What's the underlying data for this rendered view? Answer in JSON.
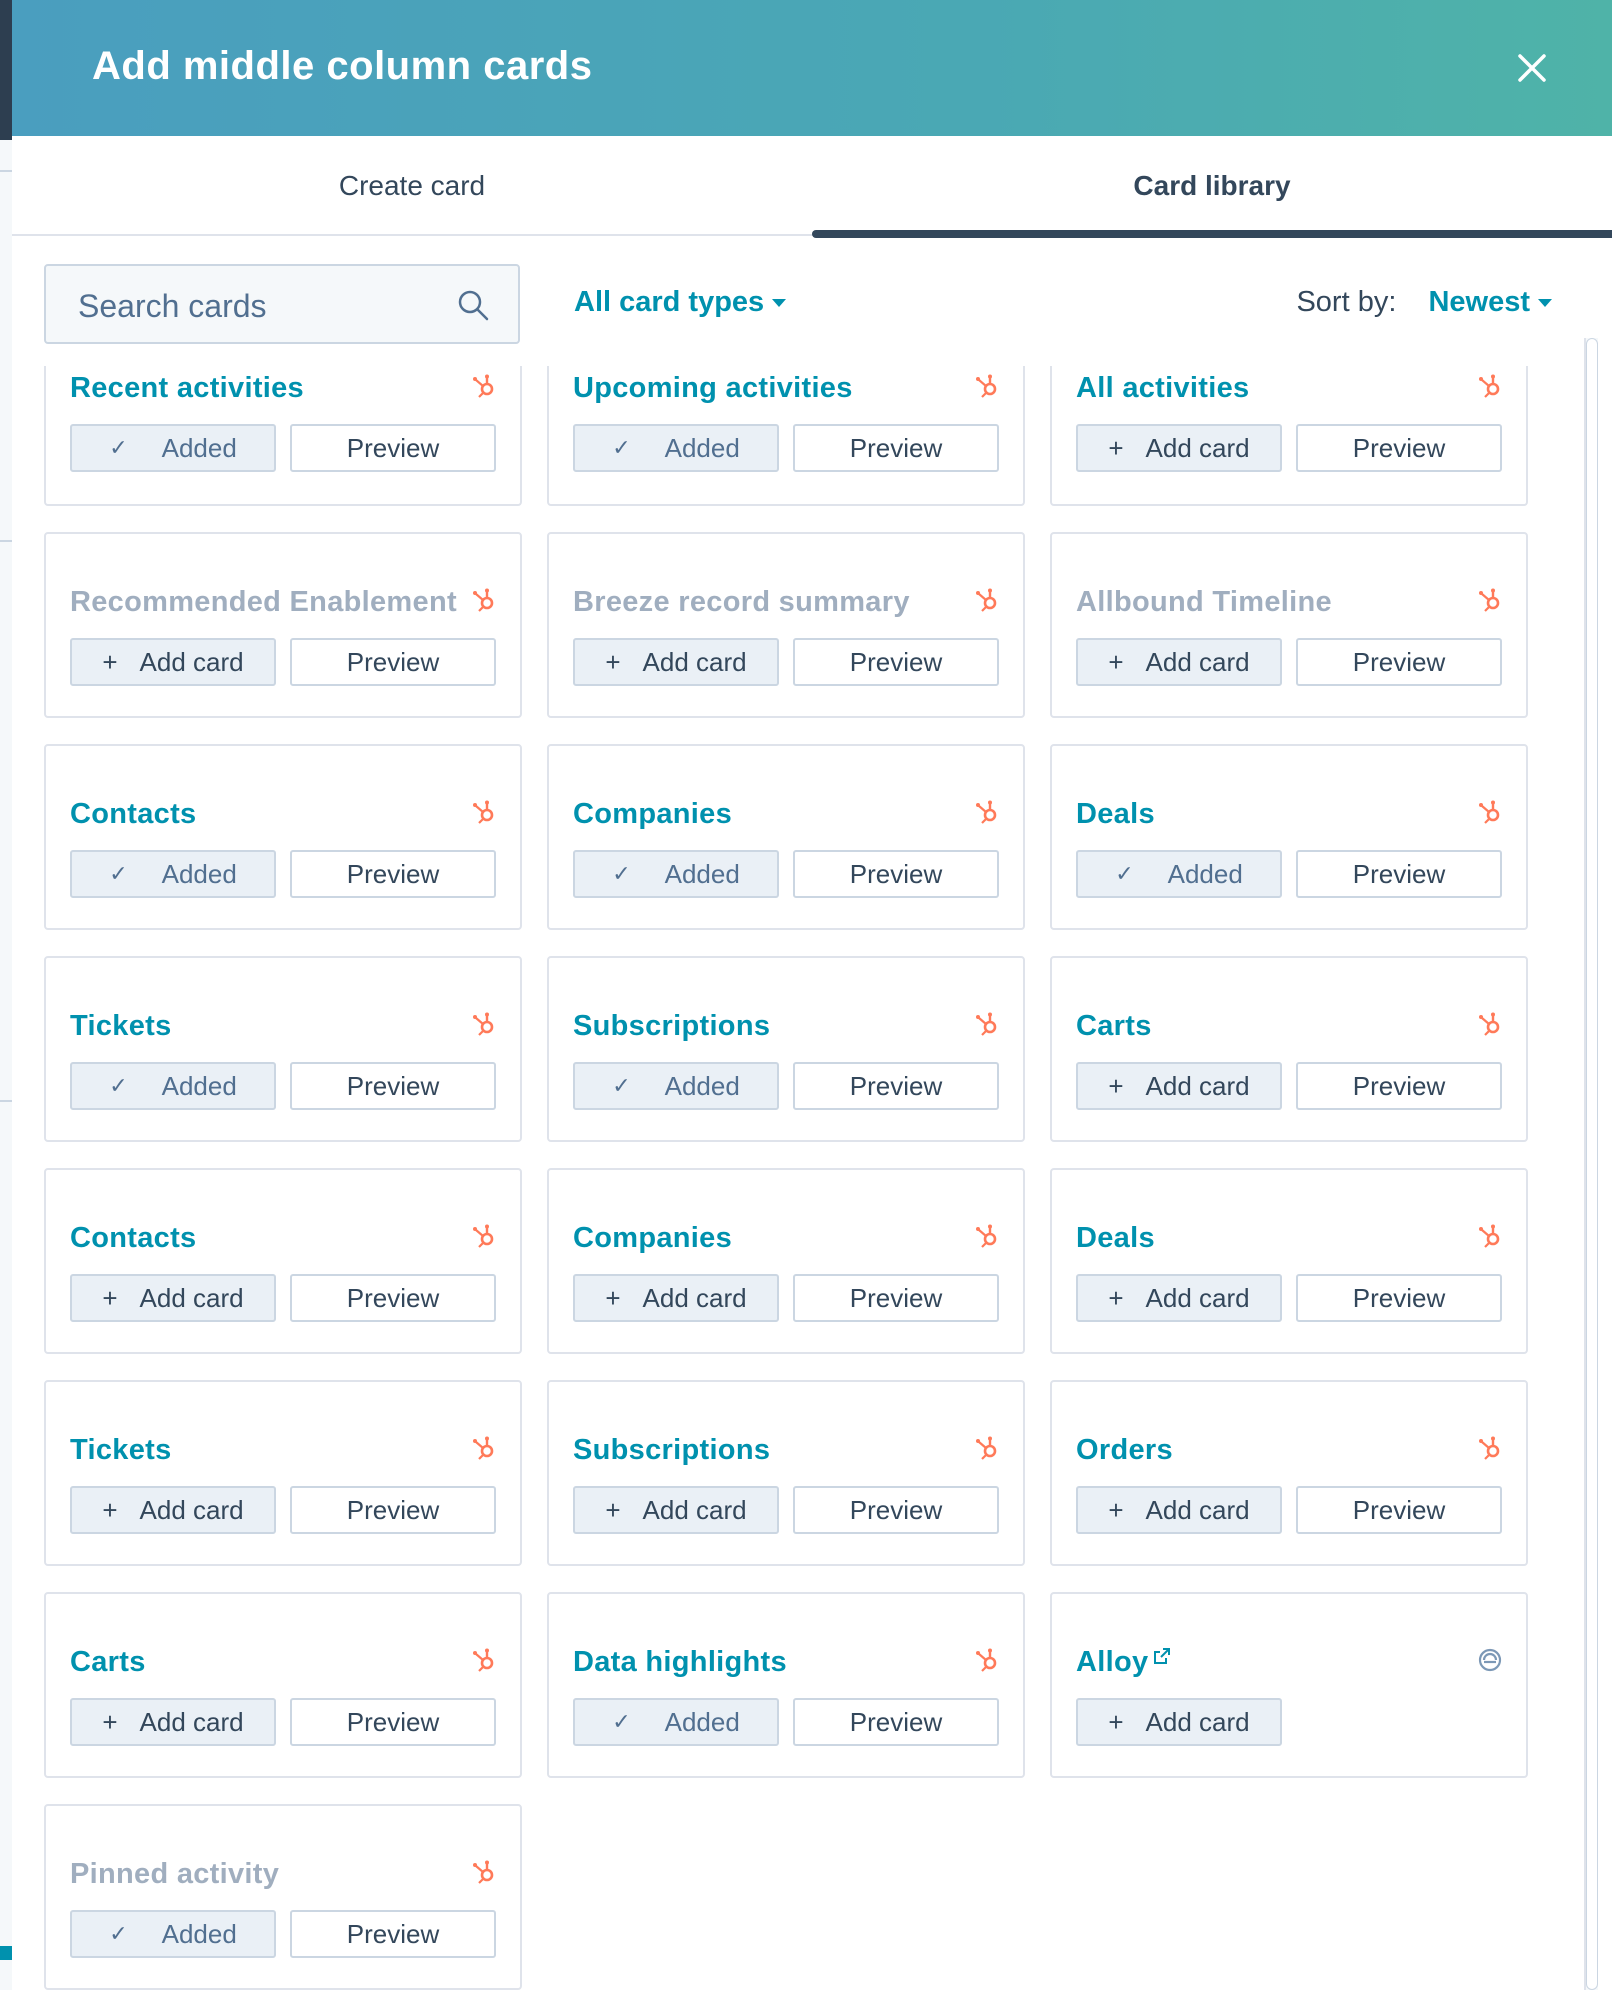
{
  "modal": {
    "title": "Add middle column cards",
    "close_icon": "close-icon"
  },
  "tabs": [
    {
      "label": "Create card",
      "active": false
    },
    {
      "label": "Card library",
      "active": true
    }
  ],
  "toolbar": {
    "search_placeholder": "Search cards",
    "filter_label": "All card types",
    "sort_label": "Sort by:",
    "sort_value": "Newest"
  },
  "colors": {
    "accent": "#0091ae",
    "header_start": "#4a9ebf",
    "header_end": "#4fb3a8",
    "hubspot_orange": "#ff7a59",
    "muted_title": "#a0aebf"
  },
  "cards": [
    {
      "title": "Recent activities",
      "status": "Added",
      "preview": "Preview",
      "logo": "hubspot-icon"
    },
    {
      "title": "Upcoming activities",
      "status": "Added",
      "preview": "Preview",
      "logo": "hubspot-icon"
    },
    {
      "title": "All activities",
      "status": "Add card",
      "preview": "Preview",
      "logo": "hubspot-icon"
    },
    {
      "title": "Recommended Enablement",
      "status": "Add card",
      "preview": "Preview",
      "logo": "hubspot-icon",
      "muted": true
    },
    {
      "title": "Breeze record summary",
      "status": "Add card",
      "preview": "Preview",
      "logo": "hubspot-icon",
      "muted": true
    },
    {
      "title": "Allbound Timeline",
      "status": "Add card",
      "preview": "Preview",
      "logo": "hubspot-icon",
      "muted": true
    },
    {
      "title": "Contacts",
      "status": "Added",
      "preview": "Preview",
      "logo": "hubspot-icon"
    },
    {
      "title": "Companies",
      "status": "Added",
      "preview": "Preview",
      "logo": "hubspot-icon"
    },
    {
      "title": "Deals",
      "status": "Added",
      "preview": "Preview",
      "logo": "hubspot-icon"
    },
    {
      "title": "Tickets",
      "status": "Added",
      "preview": "Preview",
      "logo": "hubspot-icon"
    },
    {
      "title": "Subscriptions",
      "status": "Added",
      "preview": "Preview",
      "logo": "hubspot-icon"
    },
    {
      "title": "Carts",
      "status": "Add card",
      "preview": "Preview",
      "logo": "hubspot-icon"
    },
    {
      "title": "Contacts",
      "status": "Add card",
      "preview": "Preview",
      "logo": "hubspot-icon"
    },
    {
      "title": "Companies",
      "status": "Add card",
      "preview": "Preview",
      "logo": "hubspot-icon"
    },
    {
      "title": "Deals",
      "status": "Add card",
      "preview": "Preview",
      "logo": "hubspot-icon"
    },
    {
      "title": "Tickets",
      "status": "Add card",
      "preview": "Preview",
      "logo": "hubspot-icon"
    },
    {
      "title": "Subscriptions",
      "status": "Add card",
      "preview": "Preview",
      "logo": "hubspot-icon"
    },
    {
      "title": "Orders",
      "status": "Add card",
      "preview": "Preview",
      "logo": "hubspot-icon"
    },
    {
      "title": "Carts",
      "status": "Add card",
      "preview": "Preview",
      "logo": "hubspot-icon"
    },
    {
      "title": "Data highlights",
      "status": "Added",
      "preview": "Preview",
      "logo": "hubspot-icon"
    },
    {
      "title": "Alloy",
      "status": "Add card",
      "preview": null,
      "logo": "app-marketplace-icon",
      "external": true
    },
    {
      "title": "Pinned activity",
      "status": "Added",
      "preview": "Preview",
      "logo": "hubspot-icon",
      "muted": true
    }
  ]
}
